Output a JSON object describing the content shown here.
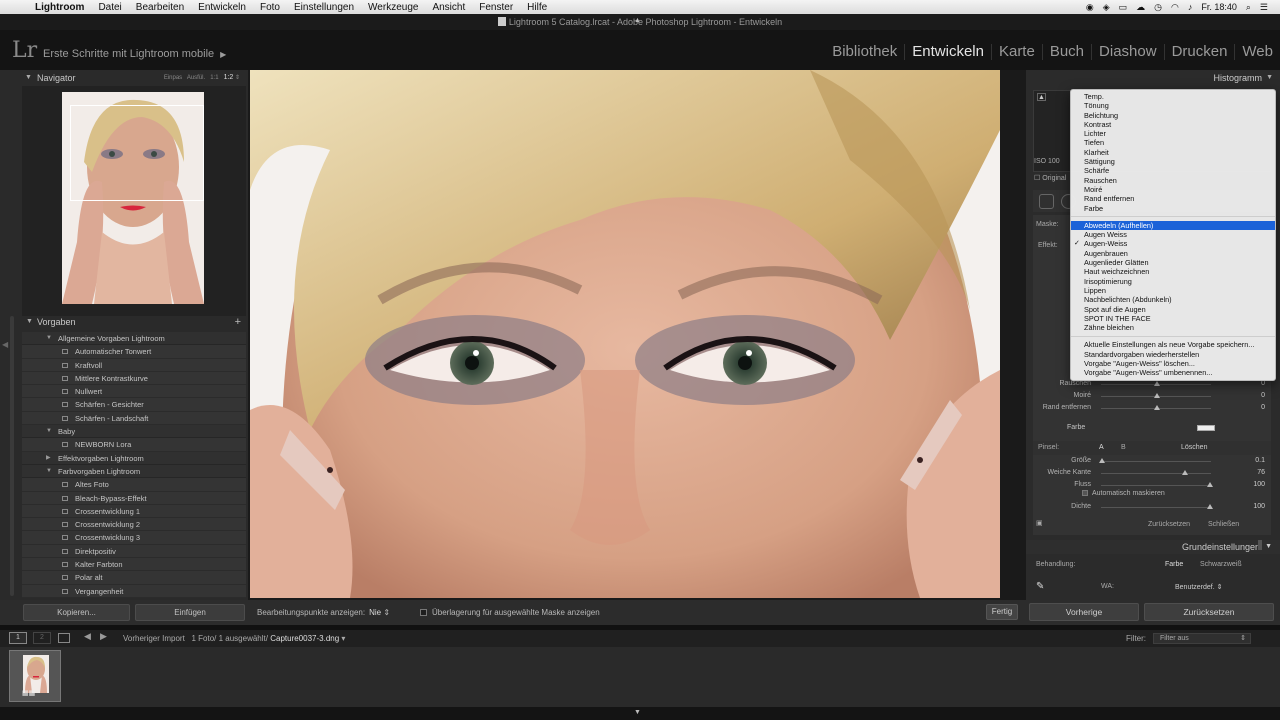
{
  "menubar": {
    "app_name": "Lightroom",
    "items": [
      "Datei",
      "Bearbeiten",
      "Entwickeln",
      "Foto",
      "Einstellungen",
      "Werkzeuge",
      "Ansicht",
      "Fenster",
      "Hilfe"
    ],
    "clock": "Fr. 18:40"
  },
  "window_title": "Lightroom 5 Catalog.lrcat - Adobe Photoshop Lightroom - Entwickeln",
  "identity_plate": "Erste Schritte mit Lightroom mobile",
  "logo": "Lr",
  "modules": [
    "Bibliothek",
    "Entwickeln",
    "Karte",
    "Buch",
    "Diashow",
    "Drucken",
    "Web"
  ],
  "active_module": "Entwickeln",
  "navigator": {
    "title": "Navigator",
    "zoom": [
      "Einpas",
      "Ausfül.",
      "1:1",
      "1:2"
    ]
  },
  "presets": {
    "title": "Vorgaben",
    "rows": [
      {
        "kind": "folder",
        "label": "Allgemeine Vorgaben Lightroom",
        "open": true
      },
      {
        "kind": "item",
        "label": "Automatischer Tonwert"
      },
      {
        "kind": "item",
        "label": "Kraftvoll"
      },
      {
        "kind": "item",
        "label": "Mittlere Kontrastkurve"
      },
      {
        "kind": "item",
        "label": "Nullwert"
      },
      {
        "kind": "item",
        "label": "Schärfen - Gesichter"
      },
      {
        "kind": "item",
        "label": "Schärfen - Landschaft"
      },
      {
        "kind": "folder",
        "label": "Baby",
        "open": true
      },
      {
        "kind": "item",
        "label": "NEWBORN Lora"
      },
      {
        "kind": "folder",
        "label": "Effektvorgaben Lightroom",
        "open": false
      },
      {
        "kind": "folder",
        "label": "Farbvorgaben Lightroom",
        "open": true
      },
      {
        "kind": "item",
        "label": "Altes Foto"
      },
      {
        "kind": "item",
        "label": "Bleach-Bypass-Effekt"
      },
      {
        "kind": "item",
        "label": "Crossentwicklung 1"
      },
      {
        "kind": "item",
        "label": "Crossentwicklung 2"
      },
      {
        "kind": "item",
        "label": "Crossentwicklung 3"
      },
      {
        "kind": "item",
        "label": "Direktpositiv"
      },
      {
        "kind": "item",
        "label": "Kalter Farbton"
      },
      {
        "kind": "item",
        "label": "Polar alt"
      },
      {
        "kind": "item",
        "label": "Vergangenheit"
      }
    ]
  },
  "left_buttons": {
    "copy": "Kopieren...",
    "paste": "Einfügen"
  },
  "toolbar": {
    "edit_points_label": "Bearbeitungspunkte anzeigen:",
    "edit_points_value": "Nie",
    "overlay_label": "Überlagerung für ausgewählte Maske anzeigen",
    "done": "Fertig"
  },
  "histogram": {
    "title": "Histogramm",
    "iso": "ISO 100",
    "original": "Original"
  },
  "mask_panel": {
    "mask_label": "Maske:",
    "effect_label": "Effekt:",
    "sliders": [
      {
        "label": "Rauschen",
        "value": "0"
      },
      {
        "label": "Moiré",
        "value": "0"
      },
      {
        "label": "Rand entfernen",
        "value": "0"
      }
    ],
    "color_label": "Farbe",
    "brush_label": "Pinsel:",
    "brush_a": "A",
    "brush_b": "B",
    "brush_clear": "Löschen",
    "brush_sliders": [
      {
        "label": "Größe",
        "value": "0.1"
      },
      {
        "label": "Weiche Kante",
        "value": "76"
      },
      {
        "label": "Fluss",
        "value": "100"
      }
    ],
    "auto_mask": "Automatisch maskieren",
    "density_label": "Dichte",
    "density_value": "100",
    "reset": "Zurücksetzen",
    "close": "Schließen"
  },
  "basic_panel": {
    "title": "Grundeinstellungen",
    "treatment_label": "Behandlung:",
    "treatment_color": "Farbe",
    "treatment_bw": "Schwarzweiß",
    "wb_label": "WA:",
    "wb_value": "Benutzerdef."
  },
  "right_buttons": {
    "previous": "Vorherige",
    "reset": "Zurücksetzen"
  },
  "dropdown": {
    "group1": [
      "Temp.",
      "Tönung",
      "Belichtung",
      "Kontrast",
      "Lichter",
      "Tiefen",
      "Klarheit",
      "Sättigung",
      "Schärfe",
      "Rauschen",
      "Moiré",
      "Rand entfernen",
      "Farbe"
    ],
    "group2": [
      {
        "label": "Abwedeln (Aufhellen)",
        "highlighted": true,
        "checked": false
      },
      {
        "label": "Augen Weiss",
        "highlighted": false,
        "checked": false
      },
      {
        "label": "Augen-Weiss",
        "highlighted": false,
        "checked": true
      },
      {
        "label": "Augenbrauen",
        "highlighted": false,
        "checked": false
      },
      {
        "label": "Augenlieder Glätten",
        "highlighted": false,
        "checked": false
      },
      {
        "label": "Haut weichzeichnen",
        "highlighted": false,
        "checked": false
      },
      {
        "label": "Irisoptimierung",
        "highlighted": false,
        "checked": false
      },
      {
        "label": "Lippen",
        "highlighted": false,
        "checked": false
      },
      {
        "label": "Nachbelichten (Abdunkeln)",
        "highlighted": false,
        "checked": false
      },
      {
        "label": "Spot auf die Augen",
        "highlighted": false,
        "checked": false
      },
      {
        "label": "SPOT IN THE FACE",
        "highlighted": false,
        "checked": false
      },
      {
        "label": "Zähne bleichen",
        "highlighted": false,
        "checked": false
      }
    ],
    "group3": [
      "Aktuelle Einstellungen als neue Vorgabe speichern...",
      "Standardvorgaben wiederherstellen",
      "Vorgabe \"Augen-Weiss\" löschen...",
      "Vorgabe \"Augen-Weiss\" umbenennen..."
    ]
  },
  "filmstrip": {
    "page1": "1",
    "page2": "2",
    "source": "Vorheriger Import",
    "count": "1 Foto/ 1 ausgewählt/",
    "filename": "Capture0037-3.dng",
    "filter_label": "Filter:",
    "filter_value": "Filter aus"
  },
  "colors": {
    "accent": "#1b62d8",
    "panel": "#2b2b2b",
    "background": "#111111"
  }
}
